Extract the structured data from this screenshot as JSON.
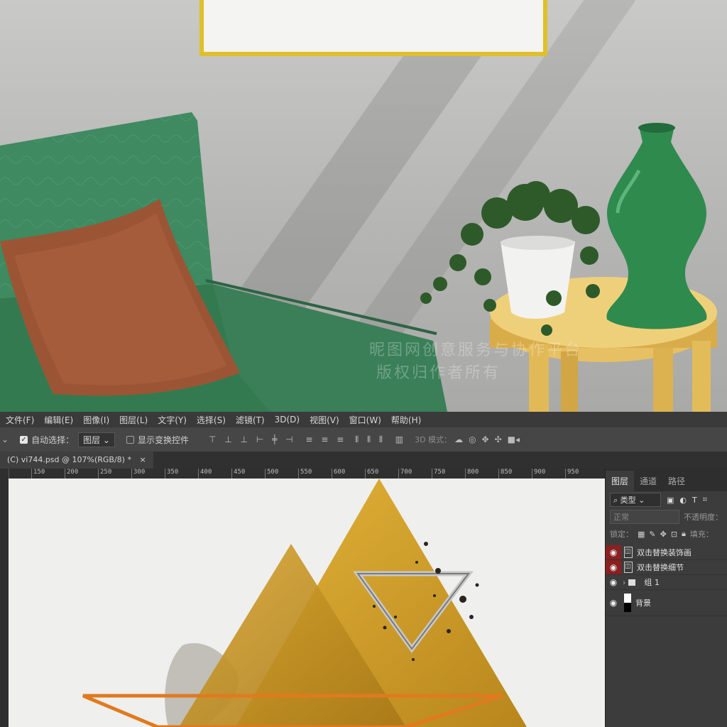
{
  "watermark": {
    "line1": "昵图网创意服务与协作平台",
    "line2": "版权归作者所有"
  },
  "menu": [
    "文件(F)",
    "编辑(E)",
    "图像(I)",
    "图层(L)",
    "文字(Y)",
    "选择(S)",
    "滤镜(T)",
    "3D(D)",
    "视图(V)",
    "窗口(W)",
    "帮助(H)"
  ],
  "options": {
    "auto_select_label": "自动选择：",
    "auto_select_value": "图层",
    "show_transform_label": "显示变换控件",
    "mode_3d_label": "3D 模式："
  },
  "document_tab": {
    "title": "(C) vi744.psd @ 107%(RGB/8) *",
    "close": "×"
  },
  "ruler_labels": [
    "150",
    "200",
    "250",
    "300",
    "350",
    "400",
    "450",
    "500",
    "550",
    "600",
    "650",
    "700",
    "750",
    "800",
    "850",
    "900",
    "950"
  ],
  "layers_panel": {
    "tabs": [
      "图层",
      "通道",
      "路径"
    ],
    "filter_value": "类型",
    "blend_mode": "正常",
    "opacity_label": "不透明度：",
    "lock_label": "锁定：",
    "fill_label": "填充：",
    "layers": [
      {
        "name": "双击替换装饰画",
        "type": "smart",
        "selected": true
      },
      {
        "name": "双击替换细节",
        "type": "smart",
        "selected": true
      },
      {
        "name": "组 1",
        "type": "group",
        "selected": false
      },
      {
        "name": "背景",
        "type": "background",
        "selected": false
      }
    ]
  },
  "colors": {
    "accent_red": "#8a2020",
    "gold": "#d9a82a",
    "orange": "#e07a1f",
    "frame_gold": "#e0c02a"
  }
}
